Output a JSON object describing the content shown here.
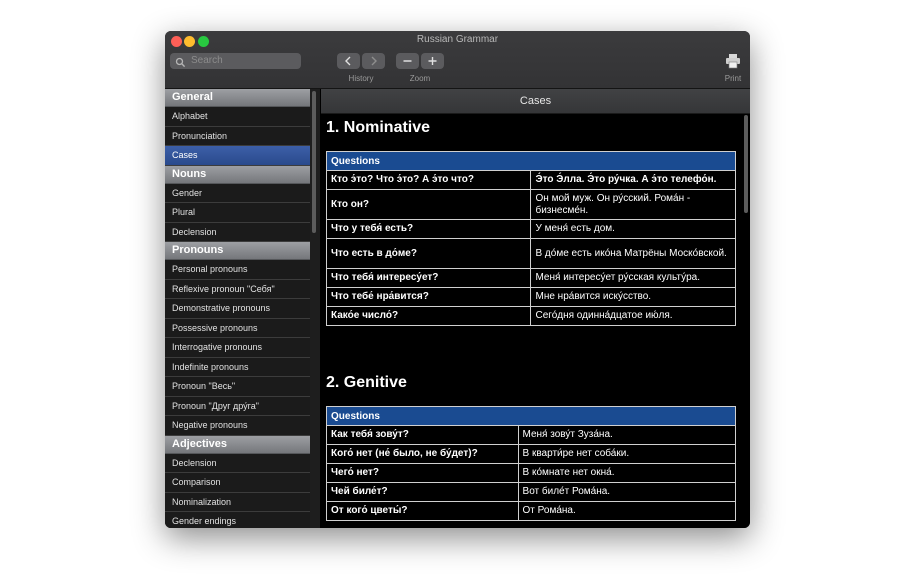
{
  "window": {
    "title": "Russian Grammar"
  },
  "toolbar": {
    "search_placeholder": "Search",
    "history_label": "History",
    "zoom_label": "Zoom",
    "print_label": "Print"
  },
  "sidebar": {
    "sections": [
      {
        "title": "General",
        "items": [
          "Alphabet",
          "Pronunciation",
          "Cases"
        ]
      },
      {
        "title": "Nouns",
        "items": [
          "Gender",
          "Plural",
          "Declension"
        ]
      },
      {
        "title": "Pronouns",
        "items": [
          "Personal pronouns",
          "Reflexive pronoun \"Себя\"",
          "Demonstrative pronouns",
          "Possessive pronouns",
          "Interrogative pronouns",
          "Indefinite pronouns",
          "Pronoun \"Весь\"",
          "Pronoun \"Друг дру́га\"",
          "Negative pronouns"
        ]
      },
      {
        "title": "Adjectives",
        "items": [
          "Declension",
          "Comparison",
          "Nominalization",
          "Gender endings"
        ]
      }
    ],
    "selected": "Cases"
  },
  "content": {
    "header": "Cases",
    "sections": [
      {
        "heading": "1. Nominative",
        "table_header": "Questions",
        "rows": [
          [
            "Кто э́то? Что э́то? А э́то что?",
            "Э́то Э́лла. Э́то ру́чка. А э́то телефо́н."
          ],
          [
            "Кто он?",
            "Он мой муж. Он ру́сский. Рома́н - бизнесме́н."
          ],
          [
            "Что у тебя́ есть?",
            "У меня́ есть дом."
          ],
          [
            "Что есть в до́ме?",
            "В до́ме есть ико́на Матрёны Моско́вской."
          ],
          [
            "Что тебя́ интересу́ет?",
            "Меня́ интересу́ет ру́сская культу́ра."
          ],
          [
            "Что тебе́ нра́вится?",
            "Мне нра́вится иску́сство."
          ],
          [
            "Како́е число́?",
            "Сего́дня одинна́дцатое ию́ля."
          ]
        ]
      },
      {
        "heading": "2. Genitive",
        "table_header": "Questions",
        "rows": [
          [
            "Как тебя́ зову́т?",
            "Меня́ зову́т Зуза́на."
          ],
          [
            "Кого́ нет (не́ было, не бу́дет)?",
            "В кварти́ре нет соба́ки."
          ],
          [
            "Чего́ нет?",
            "В ко́мнате нет окна́."
          ],
          [
            "Чей биле́т?",
            "Вот биле́т Рома́на."
          ],
          [
            "От кого́ цветы́?",
            "От Рома́на."
          ]
        ]
      }
    ]
  },
  "colors": {
    "accent": "#1a4b91",
    "selection": "#2f539a"
  }
}
